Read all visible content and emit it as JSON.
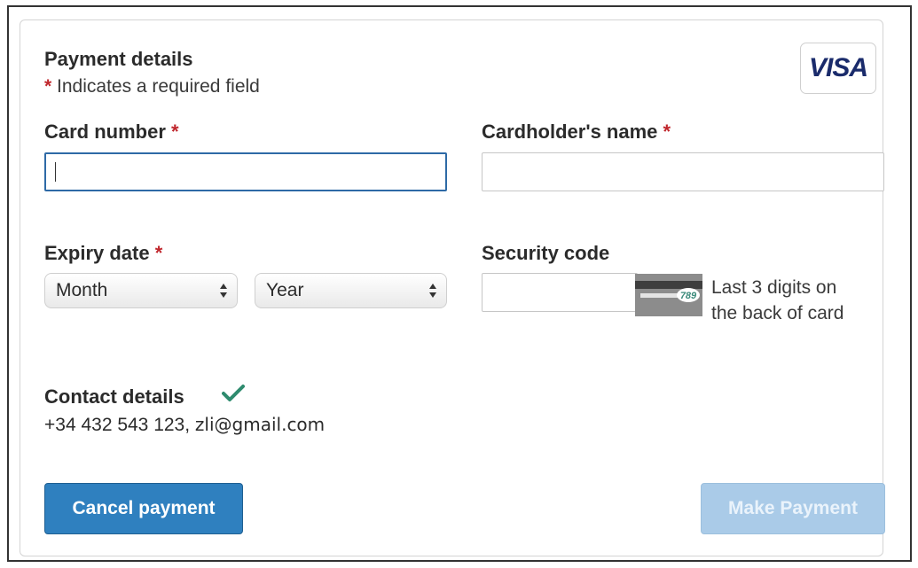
{
  "form": {
    "title": "Payment details",
    "required_star": "*",
    "required_note": "Indicates a required field",
    "brand": "VISA"
  },
  "fields": {
    "card_number": {
      "label": "Card number",
      "value": ""
    },
    "cardholder_name": {
      "label": "Cardholder's name",
      "value": ""
    },
    "expiry": {
      "label": "Expiry date",
      "month": "Month",
      "year": "Year"
    },
    "security_code": {
      "label": "Security code",
      "value": "",
      "card_digits": "789",
      "hint_line1": "Last 3 digits on",
      "hint_line2": "the back of card"
    }
  },
  "contact": {
    "title": "Contact details",
    "phone": "+34 432 543 123,",
    "email": "zli@gmail.com"
  },
  "buttons": {
    "cancel": "Cancel payment",
    "pay": "Make Payment"
  },
  "colors": {
    "accent": "#2f80bf",
    "required": "#c0272d",
    "check": "#2e8b6e",
    "disabled_button": "#aacbe8"
  }
}
